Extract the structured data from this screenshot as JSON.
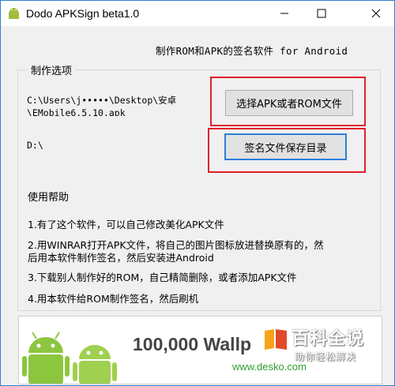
{
  "window": {
    "title": "Dodo APKSign beta1.0"
  },
  "header": {
    "tagline": "制作ROM和APK的签名软件 for Android"
  },
  "options": {
    "group_label": "制作选项",
    "source_path": "C:\\Users\\j•••••\\Desktop\\安卓\n\\EMobile6.5.10.apk",
    "select_button_label": "选择APK或者ROM文件",
    "output_path": "D:\\",
    "save_dir_button_label": "签名文件保存目录"
  },
  "help": {
    "title": "使用帮助",
    "items": [
      "1.有了这个软件，可以自己修改美化APK文件",
      "2.用WINRAR打开APK文件，将自己的图片图标放进替换原有的，然\n后用本软件制作签名，然后安装进Android",
      "3.下载别人制作好的ROM，自己精简删除，或者添加APK文件",
      "4.用本软件给ROM制作签名，然后刷机"
    ]
  },
  "banner": {
    "headline": "100,000 Wallp",
    "url": "www.desko.com"
  },
  "watermark": {
    "brand": "百科全说",
    "slogan": "助你轻松解决"
  },
  "colors": {
    "highlight": "#e0202a",
    "focus": "#2b7fd6",
    "android_green": "#8cc63f"
  }
}
